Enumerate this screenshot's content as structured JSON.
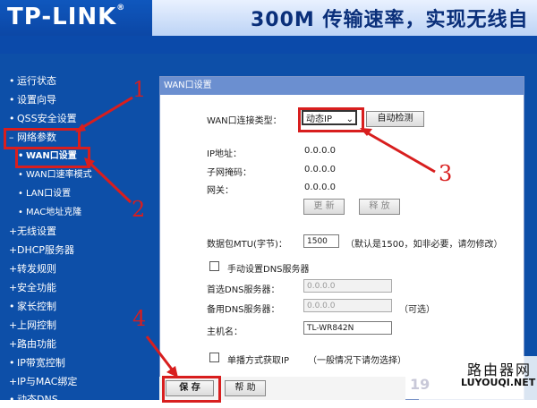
{
  "header": {
    "logo": "TP-LINK",
    "logo_mark": "®",
    "banner": "300M 传输速率，实现无线自"
  },
  "sidebar": {
    "items": [
      {
        "label": "运行状态",
        "bullet": "•"
      },
      {
        "label": "设置向导",
        "bullet": "•"
      },
      {
        "label": "QSS安全设置",
        "bullet": "•"
      },
      {
        "label": "网络参数",
        "bullet": "–"
      },
      {
        "label": "WAN口设置",
        "bullet": "•"
      },
      {
        "label": "WAN口速率模式",
        "bullet": "•"
      },
      {
        "label": "LAN口设置",
        "bullet": "•"
      },
      {
        "label": "MAC地址克隆",
        "bullet": "•"
      },
      {
        "label": "无线设置",
        "bullet": "+"
      },
      {
        "label": "DHCP服务器",
        "bullet": "+"
      },
      {
        "label": "转发规则",
        "bullet": "+"
      },
      {
        "label": "安全功能",
        "bullet": "+"
      },
      {
        "label": "家长控制",
        "bullet": "•"
      },
      {
        "label": "上网控制",
        "bullet": "+"
      },
      {
        "label": "路由功能",
        "bullet": "+"
      },
      {
        "label": "IP带宽控制",
        "bullet": "•"
      },
      {
        "label": "IP与MAC绑定",
        "bullet": "+"
      },
      {
        "label": "动态DNS",
        "bullet": "•"
      }
    ]
  },
  "panel": {
    "title": "WAN口设置",
    "wan_type_label": "WAN口连接类型：",
    "wan_type_value": "动态IP",
    "auto_detect": "自动检测",
    "ip_label": "IP地址：",
    "ip_value": "0.0.0.0",
    "mask_label": "子网掩码：",
    "mask_value": "0.0.0.0",
    "gw_label": "网关：",
    "gw_value": "0.0.0.0",
    "renew": "更 新",
    "release": "释 放",
    "mtu_label": "数据包MTU(字节)：",
    "mtu_value": "1500",
    "mtu_note": "（默认是1500，如非必要，请勿修改）",
    "manual_dns": "手动设置DNS服务器",
    "dns1_label": "首选DNS服务器：",
    "dns1_value": "0.0.0.0",
    "dns2_label": "备用DNS服务器：",
    "dns2_value": "0.0.0.0",
    "dns2_note": "（可选）",
    "host_label": "主机名：",
    "host_value": "TL-WR842N",
    "unicast": "单播方式获取IP",
    "unicast_note": "（一般情况下请勿选择）",
    "save": "保 存",
    "help": "帮 助"
  },
  "annotations": [
    "1",
    "2",
    "3",
    "4"
  ],
  "watermark": {
    "cn": "路由器网",
    "en": "LUYOUQI.NET",
    "faint": "19"
  },
  "colors": {
    "nav_bg": "#0d4fa8",
    "panel_title": "#6b8fd0",
    "annotation_red": "#d81e1e"
  }
}
